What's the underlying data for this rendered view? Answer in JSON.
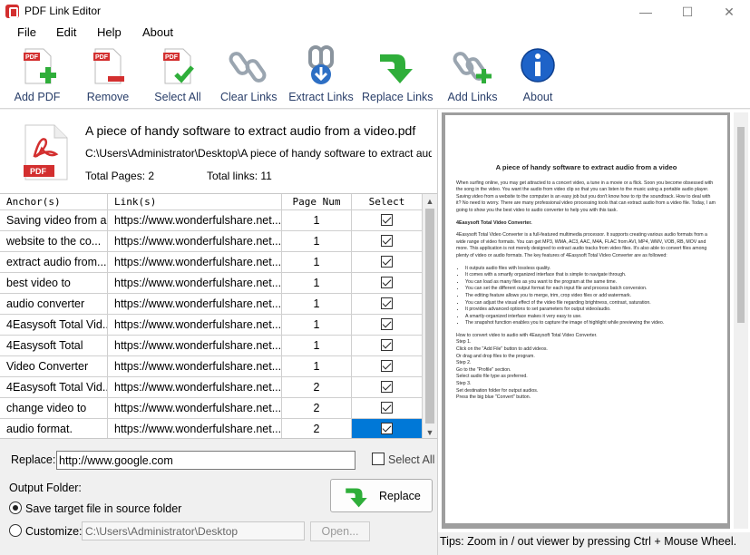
{
  "window": {
    "title": "PDF Link Editor",
    "min": "—",
    "max": "☐",
    "close": "✕"
  },
  "menu": [
    "File",
    "Edit",
    "Help",
    "About"
  ],
  "toolbar": [
    {
      "label": "Add PDF",
      "icon": "add-pdf-icon"
    },
    {
      "label": "Remove",
      "icon": "remove-pdf-icon"
    },
    {
      "label": "Select All",
      "icon": "select-all-icon"
    },
    {
      "label": "Clear Links",
      "icon": "clear-links-icon"
    },
    {
      "label": "Extract Links",
      "icon": "extract-links-icon"
    },
    {
      "label": "Replace Links",
      "icon": "replace-links-icon"
    },
    {
      "label": "Add Links",
      "icon": "add-links-icon"
    },
    {
      "label": "About",
      "icon": "info-icon"
    }
  ],
  "file": {
    "title": "A piece of handy software to extract audio from a video.pdf",
    "path": "C:\\Users\\Administrator\\Desktop\\A piece of handy software to extract audio from a video.pdf",
    "total_pages": "Total Pages: 2",
    "total_links": "Total links: 11"
  },
  "grid": {
    "headers": [
      "Anchor(s)",
      "Link(s)",
      "Page Num",
      "Select"
    ],
    "rows": [
      {
        "anchor": "Saving video from a",
        "link": "https://www.wonderfulshare.net...",
        "page": "1",
        "selected": true
      },
      {
        "anchor": "website to the co...",
        "link": "https://www.wonderfulshare.net...",
        "page": "1",
        "selected": true
      },
      {
        "anchor": "extract audio from...",
        "link": "https://www.wonderfulshare.net...",
        "page": "1",
        "selected": true
      },
      {
        "anchor": "best video to",
        "link": "https://www.wonderfulshare.net...",
        "page": "1",
        "selected": true
      },
      {
        "anchor": "audio converter",
        "link": "https://www.wonderfulshare.net...",
        "page": "1",
        "selected": true
      },
      {
        "anchor": "4Easysoft Total Vid...",
        "link": "https://www.wonderfulshare.net...",
        "page": "1",
        "selected": true
      },
      {
        "anchor": "4Easysoft Total",
        "link": "https://www.wonderfulshare.net...",
        "page": "1",
        "selected": true
      },
      {
        "anchor": "Video Converter",
        "link": "https://www.wonderfulshare.net...",
        "page": "1",
        "selected": true
      },
      {
        "anchor": "4Easysoft Total Vid...",
        "link": "https://www.wonderfulshare.net...",
        "page": "2",
        "selected": true
      },
      {
        "anchor": "change video to",
        "link": "https://www.wonderfulshare.net...",
        "page": "2",
        "selected": true
      },
      {
        "anchor": "audio format.",
        "link": "https://www.wonderfulshare.net...",
        "page": "2",
        "selected": true
      }
    ]
  },
  "replace": {
    "label": "Replace:",
    "value": "http://www.google.com",
    "select_all_label": "Select All",
    "button_label": "Replace"
  },
  "output": {
    "label": "Output Folder:",
    "option_source": "Save target file in source folder",
    "option_custom": "Customize:",
    "custom_path": "C:\\Users\\Administrator\\Desktop",
    "open_label": "Open..."
  },
  "preview": {
    "page_title": "A piece of handy software to extract audio from a video",
    "p1": "When surfing online, you may get attracted to a concert video, a tune in a movie or a flick. Soon you become obsessed with the song in the video. You want the audio from video clip so that you can listen to the music using a portable audio player. Saving video from a website to the computer is an easy job but you don't know how to rip the soundtrack. How to deal with it? No need to worry. There are many professional video processing tools that can extract audio from a video file. Today, I am going to show you the best video to audio converter to help you with this task.",
    "h2": "4Easysoft Total Video Converter.",
    "p2": "4Easysoft Total Video Converter is a full-featured multimedia processor. It supports creating various audio formats from a wide range of video formats. You can get MP3, WMA, AC3, AAC, M4A, FLAC from AVI, MP4, WMV, VOB, RB, MOV and more. This application is not merely designed to extract audio tracks from video files. It's also able to convert files among plenty of video or audio formats. The key features of 4Easysoft Total Video Converter are as followed:",
    "bullets": [
      "It outputs audio files with lossless quality.",
      "It comes with a smartly organized interface that is simple to navigate through.",
      "You can load as many files as you want to the program at the same time.",
      "You can set the different output format for each input file and process batch conversion.",
      "The editing feature allows you to merge, trim, crop video files or add watermark.",
      "You can adjust the visual effect of the video file regarding brightness, contrast, saturation.",
      "It provides advanced options to set parameters for output video/audio.",
      "A smartly-organized interface makes it very easy to use.",
      "The snapshot function enables you to capture the image of highlight while previewing the video."
    ],
    "steps": [
      "How to convert video to audio with 4Easysoft Total Video Converter.",
      "Step 1.",
      "Click on the \"Add File\" button to add videos.",
      "Or drag and drop files to the program.",
      "Step 2.",
      "Go to the \"Profile\" section.",
      "Select audio file type as preferred.",
      "Step 3.",
      "Set destination folder for output audios.",
      "Press the big blue \"Convert\" button."
    ]
  },
  "tips": "Tips: Zoom in / out viewer by pressing Ctrl + Mouse Wheel.",
  "colors": {
    "accent": "#0078d7",
    "pdf_red": "#d32f2f",
    "arrow_green": "#2fae3a",
    "label_blue": "#2a3f6a"
  }
}
